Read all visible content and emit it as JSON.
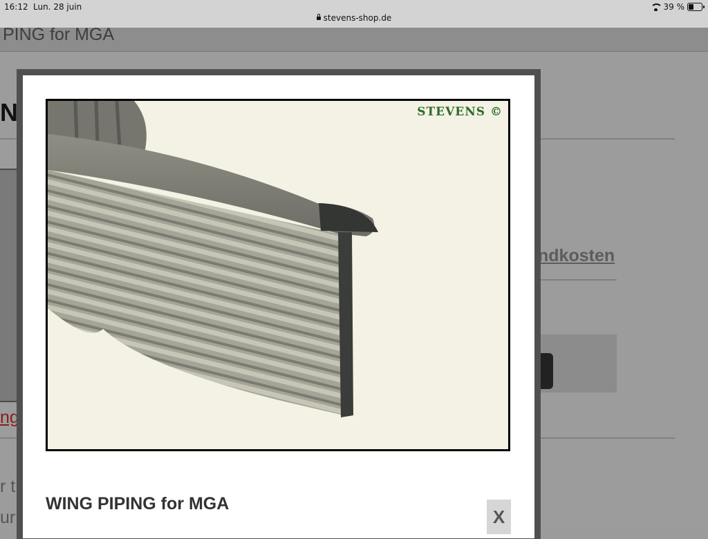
{
  "status_bar": {
    "time": "16:12",
    "date": "Lun. 28 juin",
    "url": "stevens-shop.de",
    "battery": "39 %",
    "battery_level": 0.39
  },
  "page": {
    "header_title": "PING for MGA",
    "heading_fragment": "N",
    "link_fragment": "ndkosten",
    "red_link_fragment": "ng",
    "text_fragment_1": "r th",
    "text_fragment_2": "ur"
  },
  "modal": {
    "image_watermark": "STEVENS ©",
    "title": "WING PIPING for MGA",
    "close_label": "X"
  },
  "colors": {
    "overlay": "#9b9b9b",
    "modal_border": "#505050",
    "image_background": "#f3f2e4",
    "watermark": "#2f6a2a",
    "red_link": "#8a1c1c"
  }
}
